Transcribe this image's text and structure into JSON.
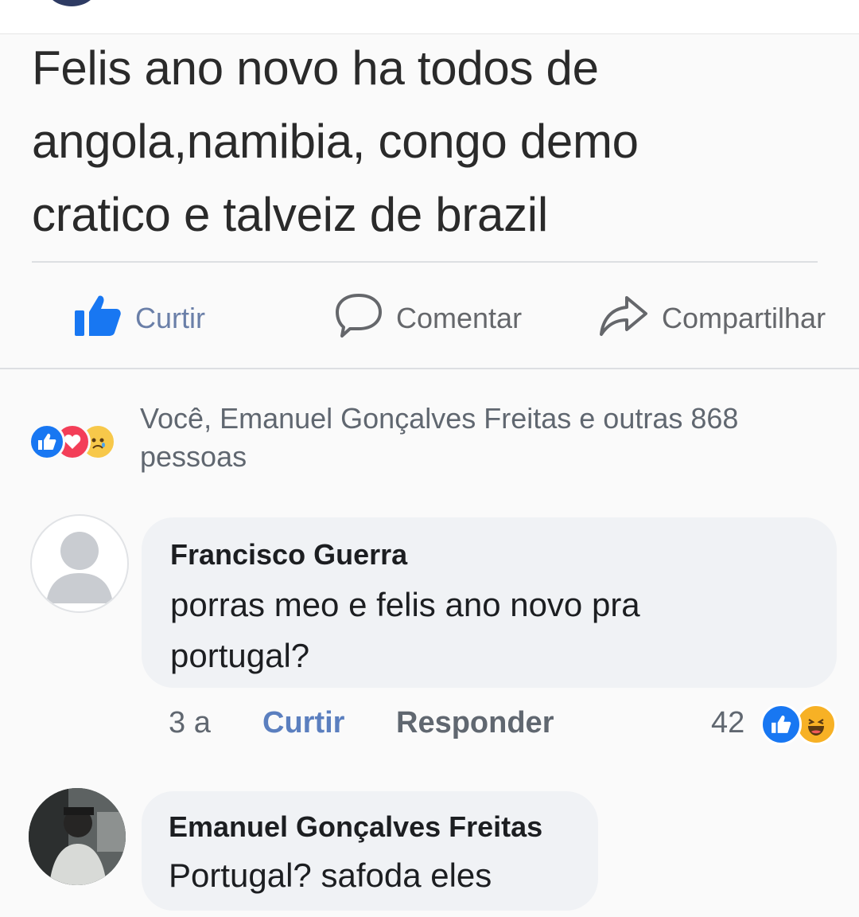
{
  "post": {
    "text_lines": [
      "Felis ano novo ha todos de",
      "angola,namibia, congo demo",
      "cratico e talveiz de brazil"
    ]
  },
  "actions": {
    "like_label": "Curtir",
    "comment_label": "Comentar",
    "share_label": "Compartilhar"
  },
  "reactions": {
    "summary_line1": "Você, Emanuel Gonçalves Freitas e outras 868",
    "summary_line2": "pessoas",
    "icons": [
      "like-reaction-icon",
      "love-reaction-icon",
      "sad-reaction-icon"
    ]
  },
  "comments": [
    {
      "author": "Francisco Guerra",
      "text_lines": [
        "porras meo e felis ano novo pra",
        "portugal?"
      ],
      "age": "3 a",
      "like_label": "Curtir",
      "reply_label": "Responder",
      "reaction_count": "42",
      "reaction_icons": [
        "like-reaction-icon",
        "haha-reaction-icon"
      ]
    },
    {
      "author": "Emanuel Gonçalves Freitas",
      "text_lines": [
        "Portugal? safoda eles"
      ]
    }
  ],
  "colors": {
    "like_blue": "#1877f2",
    "love_red": "#f33e58",
    "haha_yellow": "#f7b125",
    "muted_text": "#606770"
  }
}
